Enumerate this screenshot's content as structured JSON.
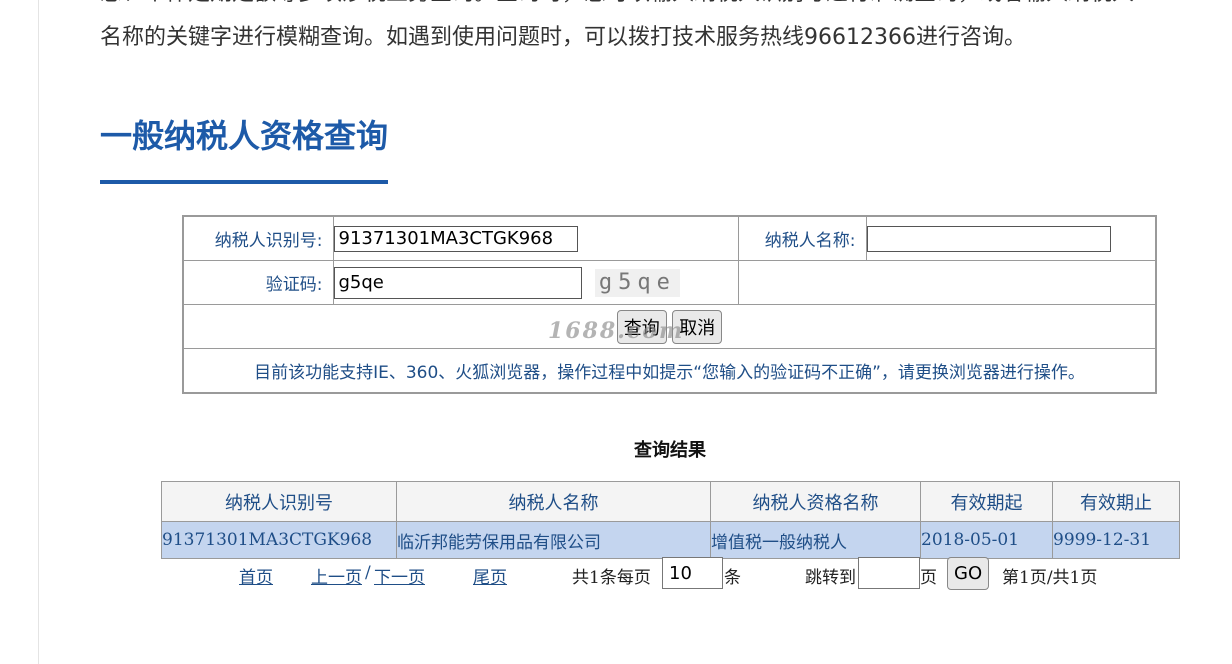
{
  "intro": {
    "line1": "息、个体定期定额等多项涉税业务查询。查询时，您可以输入纳税人识别号进行准确查询，或者输入纳税人",
    "line2": "名称的关键字进行模糊查询。如遇到使用问题时，可以拨打技术服务热线96612366进行咨询。"
  },
  "section_title": "一般纳税人资格查询",
  "form": {
    "taxpayer_id_label": "纳税人识别号:",
    "taxpayer_id_value": "91371301MA3CTGK968",
    "taxpayer_name_label": "纳税人名称:",
    "taxpayer_name_value": "",
    "captcha_label": "验证码:",
    "captcha_value": "g5qe",
    "captcha_image_text": "g5qe",
    "query_button": "查询",
    "cancel_button": "取消",
    "notice": "目前该功能支持IE、360、火狐浏览器，操作过程中如提示“您输入的验证码不正确”，请更换浏览器进行操作。"
  },
  "watermark": "1688.com",
  "results": {
    "title": "查询结果",
    "headers": [
      "纳税人识别号",
      "纳税人名称",
      "纳税人资格名称",
      "有效期起",
      "有效期止"
    ],
    "rows": [
      [
        "91371301MA3CTGK968",
        "临沂邦能劳保用品有限公司",
        "增值税一般纳税人",
        "2018-05-01",
        "9999-12-31"
      ]
    ]
  },
  "pager": {
    "first": "首页",
    "prev": "上一页",
    "separator": "/",
    "next": "下一页",
    "last": "尾页",
    "total_prefix": "共1条每页",
    "per_page": "10",
    "per_page_unit": "条",
    "jump_label": "跳转到",
    "jump_value": "",
    "page_unit": "页",
    "go_button": "GO",
    "page_status": "第1页/共1页"
  },
  "colors": {
    "title_blue": "#1d5aa8",
    "link_blue": "#1f4e87",
    "row_highlight": "#c4d5ef"
  }
}
